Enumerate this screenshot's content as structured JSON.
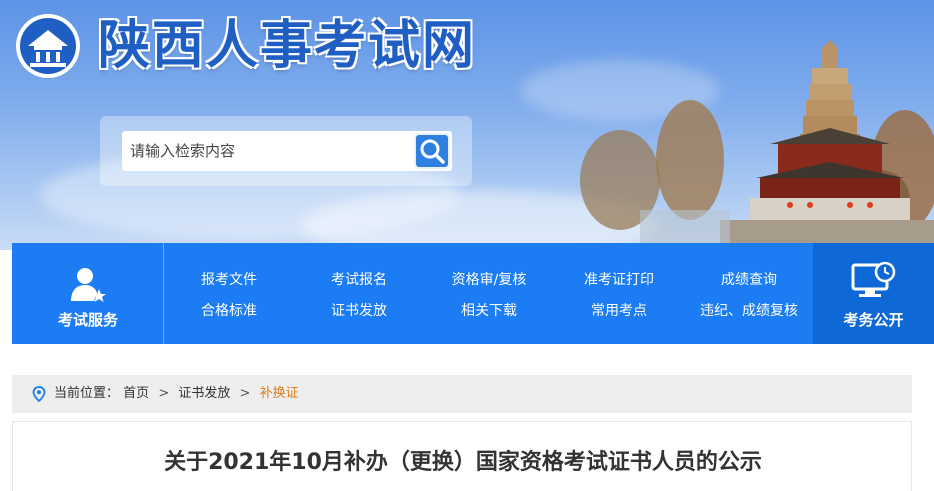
{
  "header": {
    "site_title": "陕西人事考试网",
    "search": {
      "placeholder": "请输入检索内容"
    },
    "icons": {
      "logo": "pavilion-logo",
      "search": "search-icon"
    }
  },
  "nav": {
    "left": {
      "label": "考试服务",
      "icon": "user-star-icon"
    },
    "links": [
      [
        "报考文件",
        "考试报名",
        "资格审/复核",
        "准考证打印",
        "成绩查询"
      ],
      [
        "合格标准",
        "证书发放",
        "相关下载",
        "常用考点",
        "违纪、成绩复核"
      ]
    ],
    "right": {
      "label": "考务公开",
      "icon": "monitor-clock-icon"
    }
  },
  "breadcrumb": {
    "prefix": "当前位置：",
    "items": [
      "首页",
      "证书发放"
    ],
    "separator": ">",
    "current": "补换证"
  },
  "article": {
    "title": "关于2021年10月补办（更换）国家资格考试证书人员的公示"
  },
  "colors": {
    "nav_bg": "#1b7cf4",
    "nav_accent": "#0e68d6",
    "title_blue": "#1f5fc4",
    "breadcrumb_current": "#e07b1a"
  }
}
